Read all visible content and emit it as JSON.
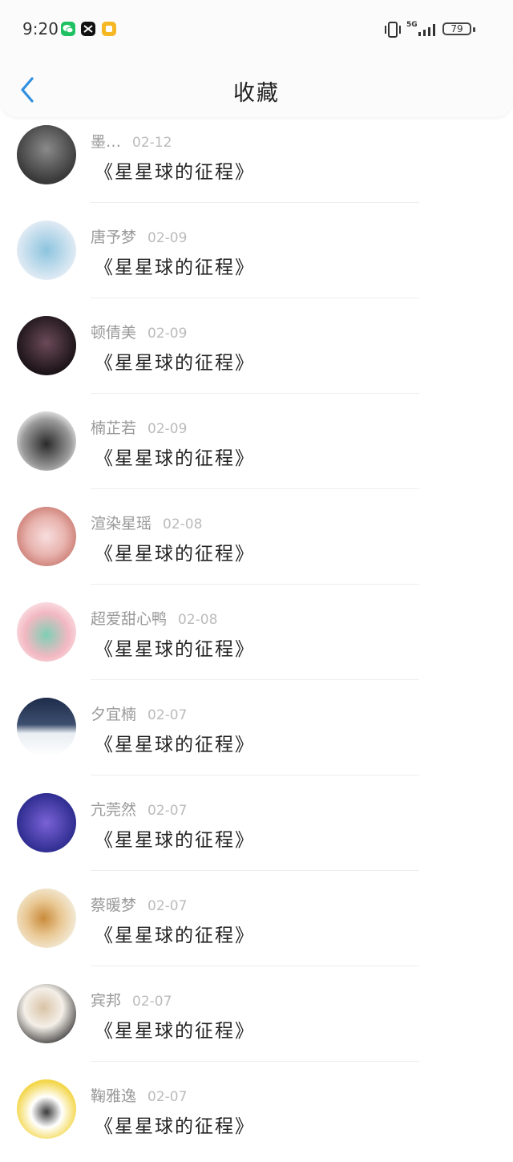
{
  "status_bar": {
    "time": "9:20",
    "network": "5G",
    "battery": "79"
  },
  "header": {
    "title": "收藏"
  },
  "items": [
    {
      "user": "墨…",
      "date": "02-12",
      "title": "《星星球的征程》",
      "avatar_colors": [
        "#3a3a3a",
        "#8a8a8a"
      ]
    },
    {
      "user": "唐予梦",
      "date": "02-09",
      "title": "《星星球的征程》",
      "avatar_colors": [
        "#dfeaf4",
        "#8cc4de"
      ]
    },
    {
      "user": "顿倩美",
      "date": "02-09",
      "title": "《星星球的征程》",
      "avatar_colors": [
        "#1c1418",
        "#6b4a58"
      ]
    },
    {
      "user": "楠芷若",
      "date": "02-09",
      "title": "《星星球的征程》",
      "avatar_colors": [
        "#f2f2f2",
        "#2a2a2a"
      ]
    },
    {
      "user": "渲染星瑶",
      "date": "02-08",
      "title": "《星星球的征程》",
      "avatar_colors": [
        "#f7dede",
        "#c8786e"
      ]
    },
    {
      "user": "超爱甜心鸭",
      "date": "02-08",
      "title": "《星星球的征程》",
      "avatar_colors": [
        "#fbe3e6",
        "#7ecfb5"
      ]
    },
    {
      "user": "夕宜楠",
      "date": "02-07",
      "title": "《星星球的征程》",
      "avatar_colors": [
        "#1e2c4a",
        "#e9eef3"
      ]
    },
    {
      "user": "亢莞然",
      "date": "02-07",
      "title": "《星星球的征程》",
      "avatar_colors": [
        "#2a2a8c",
        "#7a62d6"
      ]
    },
    {
      "user": "蔡暖梦",
      "date": "02-07",
      "title": "《星星球的征程》",
      "avatar_colors": [
        "#f3ead6",
        "#c98b3c"
      ]
    },
    {
      "user": "宾邦",
      "date": "02-07",
      "title": "《星星球的征程》",
      "avatar_colors": [
        "#f4efe8",
        "#2a2a2a"
      ]
    },
    {
      "user": "鞠雅逸",
      "date": "02-07",
      "title": "《星星球的征程》",
      "avatar_colors": [
        "#f3d64a",
        "#3a3a3a"
      ]
    }
  ],
  "colors": {
    "accent": "#2f8fe0",
    "username": "#999999",
    "date": "#bbbbbb",
    "title_text": "#222222"
  }
}
